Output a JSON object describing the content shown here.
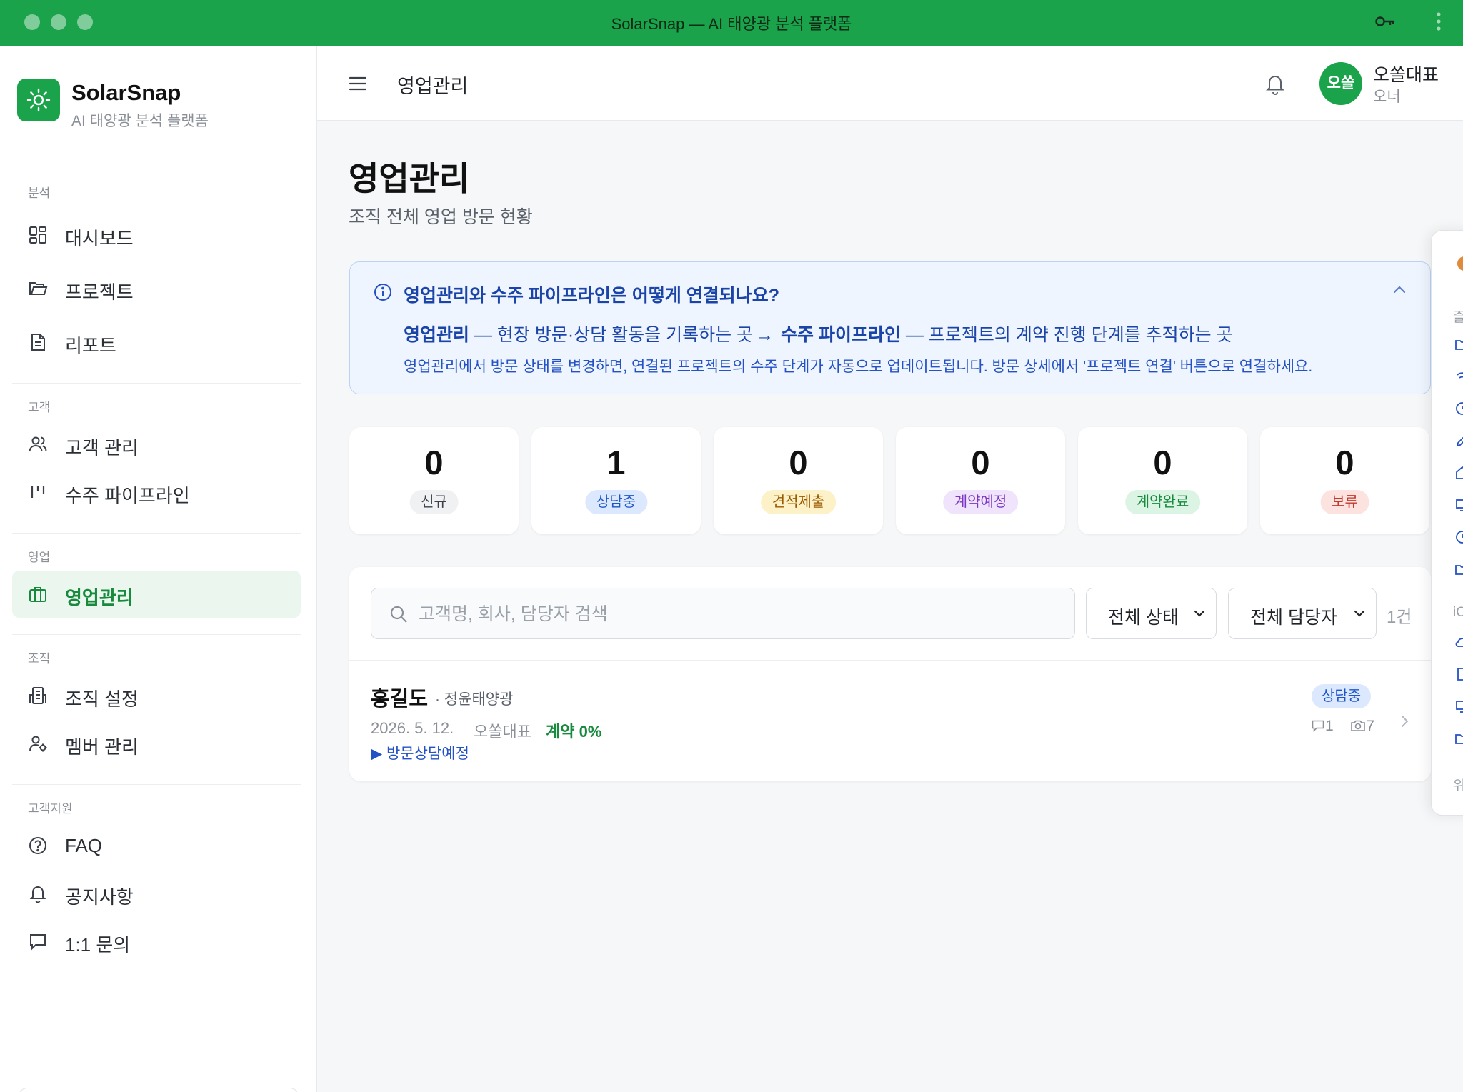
{
  "window": {
    "title": "SolarSnap — AI 태양광 분석 플랫폼"
  },
  "brand": {
    "name": "SolarSnap",
    "tagline": "AI 태양광 분석 플랫폼"
  },
  "sidebar": {
    "sections": [
      {
        "label": "분석",
        "items": [
          {
            "label": "대시보드",
            "icon": "dashboard-icon"
          },
          {
            "label": "프로젝트",
            "icon": "folder-icon"
          },
          {
            "label": "리포트",
            "icon": "document-icon"
          }
        ]
      },
      {
        "label": "고객",
        "items": [
          {
            "label": "고객 관리",
            "icon": "users-icon"
          },
          {
            "label": "수주 파이프라인",
            "icon": "pipeline-icon"
          }
        ]
      },
      {
        "label": "영업",
        "items": [
          {
            "label": "영업관리",
            "icon": "briefcase-icon",
            "active": true
          }
        ]
      },
      {
        "label": "조직",
        "items": [
          {
            "label": "조직 설정",
            "icon": "building-icon"
          },
          {
            "label": "멤버 관리",
            "icon": "user-settings-icon"
          }
        ]
      },
      {
        "label": "고객지원",
        "items": [
          {
            "label": "FAQ",
            "icon": "help-circle-icon"
          },
          {
            "label": "공지사항",
            "icon": "bell-icon"
          },
          {
            "label": "1:1 문의",
            "icon": "message-icon"
          }
        ]
      }
    ]
  },
  "header": {
    "title": "영업관리",
    "user": {
      "avatar_text": "오쏠",
      "name": "오쏠대표",
      "role": "오너"
    }
  },
  "page": {
    "title": "영업관리",
    "subtitle": "조직 전체 영업 방문 현황"
  },
  "info": {
    "title": "영업관리와 수주 파이프라인은 어떻게 연결되나요?",
    "line1_a_bold": "영업관리",
    "line1_a_rest": " — 현장 방문·상담 활동을 기록하는 곳",
    "line1_arrow": "→",
    "line1_b_bold": "수주 파이프라인",
    "line1_b_rest": " — 프로젝트의 계약 진행 단계를 추적하는 곳",
    "line2": "영업관리에서 방문 상태를 변경하면, 연결된 프로젝트의 수주 단계가 자동으로 업데이트됩니다. 방문 상세에서 '프로젝트 연결' 버튼으로 연결하세요."
  },
  "stats": [
    {
      "value": "0",
      "label": "신규",
      "bg": "#f0f1f3",
      "fg": "#3b4048"
    },
    {
      "value": "1",
      "label": "상담중",
      "bg": "#dbe8fd",
      "fg": "#1e56c8"
    },
    {
      "value": "0",
      "label": "견적제출",
      "bg": "#fdf1c7",
      "fg": "#9a5a00"
    },
    {
      "value": "0",
      "label": "계약예정",
      "bg": "#efe4fb",
      "fg": "#7a35c2"
    },
    {
      "value": "0",
      "label": "계약완료",
      "bg": "#dcf4e3",
      "fg": "#178a3e"
    },
    {
      "value": "0",
      "label": "보류",
      "bg": "#fde3e0",
      "fg": "#c0392b"
    }
  ],
  "filters": {
    "search_placeholder": "고객명, 회사, 담당자 검색",
    "status_select": "전체 상태",
    "owner_select": "전체 담당자",
    "count": "1건"
  },
  "visits": [
    {
      "name": "홍길도",
      "company": "· 정윤태양광",
      "date": "2026. 5. 12.",
      "owner": "오쏠대표",
      "contract": "계약 0%",
      "next": "▶ 방문상담예정",
      "status": "상담중",
      "comments": "1",
      "photos": "7"
    }
  ],
  "side_panel": {
    "texts": [
      "즐",
      "iC",
      "위"
    ]
  },
  "colors": {
    "brand_green": "#1aa34a",
    "active_bg": "#eaf6ee",
    "info_blue": "#1a44a8"
  }
}
